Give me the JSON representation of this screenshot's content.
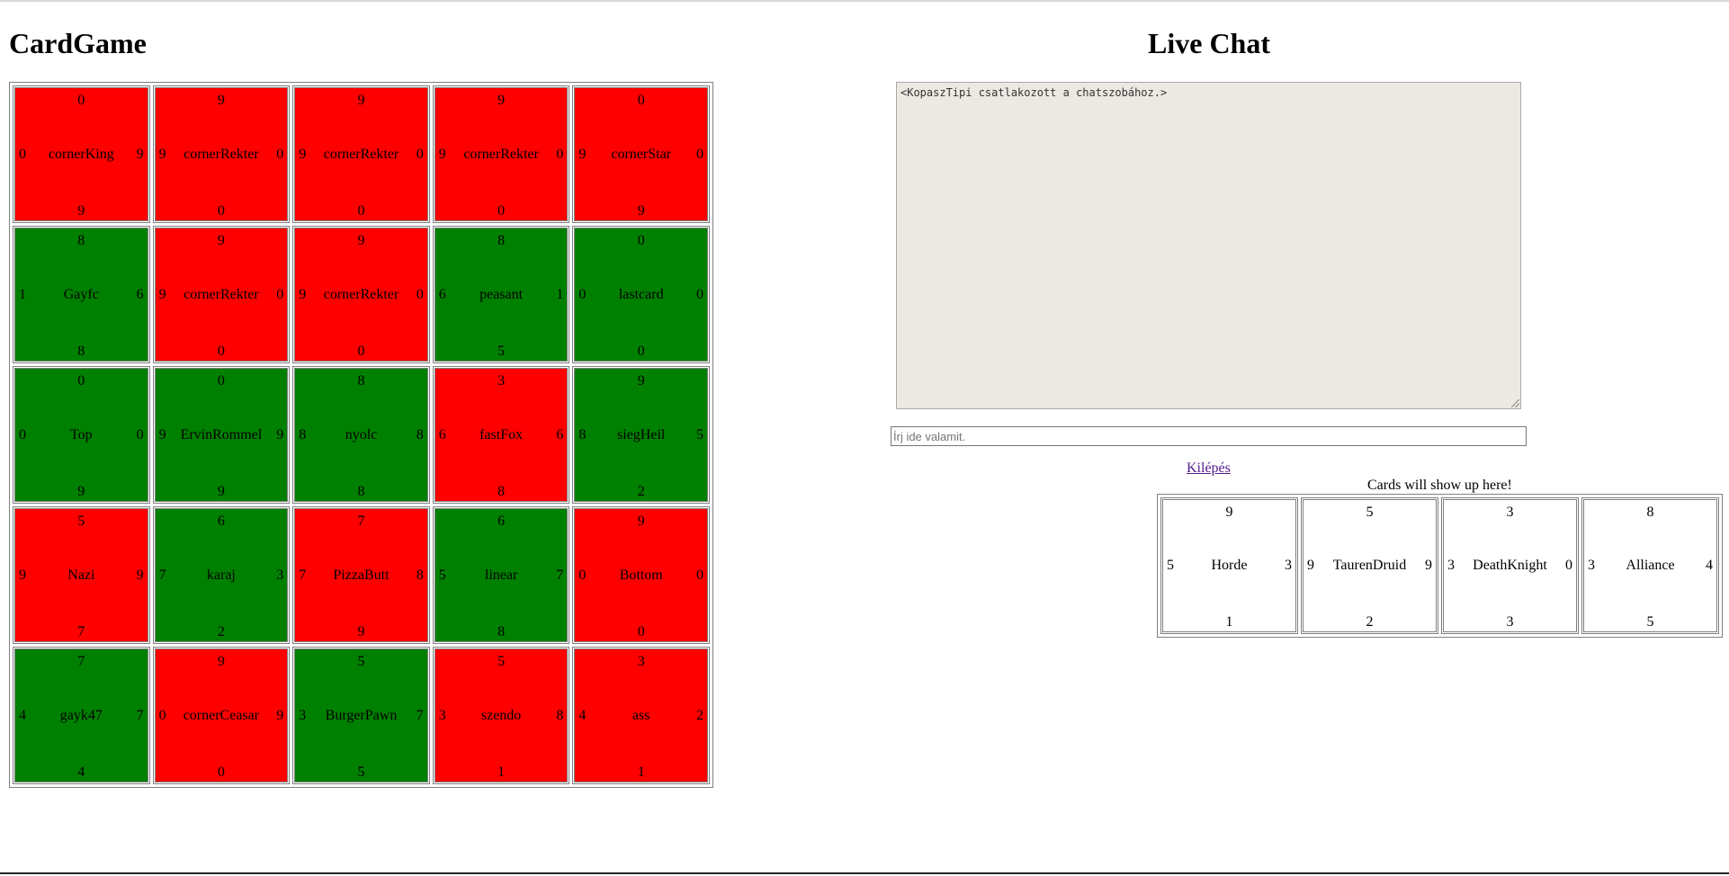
{
  "game": {
    "title": "CardGame",
    "colors": {
      "red": "#ff0000",
      "green": "#008000"
    },
    "board": [
      {
        "name": "cornerKing",
        "color": "red",
        "top": "0",
        "left": "0",
        "right": "9",
        "bottom": "9"
      },
      {
        "name": "cornerRekter",
        "color": "red",
        "top": "9",
        "left": "9",
        "right": "0",
        "bottom": "0"
      },
      {
        "name": "cornerRekter",
        "color": "red",
        "top": "9",
        "left": "9",
        "right": "0",
        "bottom": "0"
      },
      {
        "name": "cornerRekter",
        "color": "red",
        "top": "9",
        "left": "9",
        "right": "0",
        "bottom": "0"
      },
      {
        "name": "cornerStar",
        "color": "red",
        "top": "0",
        "left": "9",
        "right": "0",
        "bottom": "9"
      },
      {
        "name": "Gayfc",
        "color": "green",
        "top": "8",
        "left": "1",
        "right": "6",
        "bottom": "8"
      },
      {
        "name": "cornerRekter",
        "color": "red",
        "top": "9",
        "left": "9",
        "right": "0",
        "bottom": "0"
      },
      {
        "name": "cornerRekter",
        "color": "red",
        "top": "9",
        "left": "9",
        "right": "0",
        "bottom": "0"
      },
      {
        "name": "peasant",
        "color": "green",
        "top": "8",
        "left": "6",
        "right": "1",
        "bottom": "5"
      },
      {
        "name": "lastcard",
        "color": "green",
        "top": "0",
        "left": "0",
        "right": "0",
        "bottom": "0"
      },
      {
        "name": "Top",
        "color": "green",
        "top": "0",
        "left": "0",
        "right": "0",
        "bottom": "9"
      },
      {
        "name": "ErvinRommel",
        "color": "green",
        "top": "0",
        "left": "9",
        "right": "9",
        "bottom": "9"
      },
      {
        "name": "nyolc",
        "color": "green",
        "top": "8",
        "left": "8",
        "right": "8",
        "bottom": "8"
      },
      {
        "name": "fastFox",
        "color": "red",
        "top": "3",
        "left": "6",
        "right": "6",
        "bottom": "8"
      },
      {
        "name": "siegHeil",
        "color": "green",
        "top": "9",
        "left": "8",
        "right": "5",
        "bottom": "2"
      },
      {
        "name": "Nazi",
        "color": "red",
        "top": "5",
        "left": "9",
        "right": "9",
        "bottom": "7"
      },
      {
        "name": "karaj",
        "color": "green",
        "top": "6",
        "left": "7",
        "right": "3",
        "bottom": "2"
      },
      {
        "name": "PizzaButt",
        "color": "red",
        "top": "7",
        "left": "7",
        "right": "8",
        "bottom": "9"
      },
      {
        "name": "linear",
        "color": "green",
        "top": "6",
        "left": "5",
        "right": "7",
        "bottom": "8"
      },
      {
        "name": "Bottom",
        "color": "red",
        "top": "9",
        "left": "0",
        "right": "0",
        "bottom": "0"
      },
      {
        "name": "gayk47",
        "color": "green",
        "top": "7",
        "left": "4",
        "right": "7",
        "bottom": "4"
      },
      {
        "name": "cornerCeasar",
        "color": "red",
        "top": "9",
        "left": "0",
        "right": "9",
        "bottom": "0"
      },
      {
        "name": "BurgerPawn",
        "color": "green",
        "top": "5",
        "left": "3",
        "right": "7",
        "bottom": "5"
      },
      {
        "name": "szendo",
        "color": "red",
        "top": "5",
        "left": "3",
        "right": "8",
        "bottom": "1"
      },
      {
        "name": "ass",
        "color": "red",
        "top": "3",
        "left": "4",
        "right": "2",
        "bottom": "1"
      }
    ]
  },
  "chat": {
    "title": "Live Chat",
    "log": "<KopaszTipi csatlakozott a chatszobához.>",
    "input_placeholder": "Írj ide valamit.",
    "logout_label": "Kilépés"
  },
  "hand": {
    "caption": "Cards will show up here!",
    "cards": [
      {
        "name": "Horde",
        "top": "9",
        "left": "5",
        "right": "3",
        "bottom": "1"
      },
      {
        "name": "TaurenDruid",
        "top": "5",
        "left": "9",
        "right": "9",
        "bottom": "2"
      },
      {
        "name": "DeathKnight",
        "top": "3",
        "left": "3",
        "right": "0",
        "bottom": "3"
      },
      {
        "name": "Alliance",
        "top": "8",
        "left": "3",
        "right": "4",
        "bottom": "5"
      }
    ]
  }
}
